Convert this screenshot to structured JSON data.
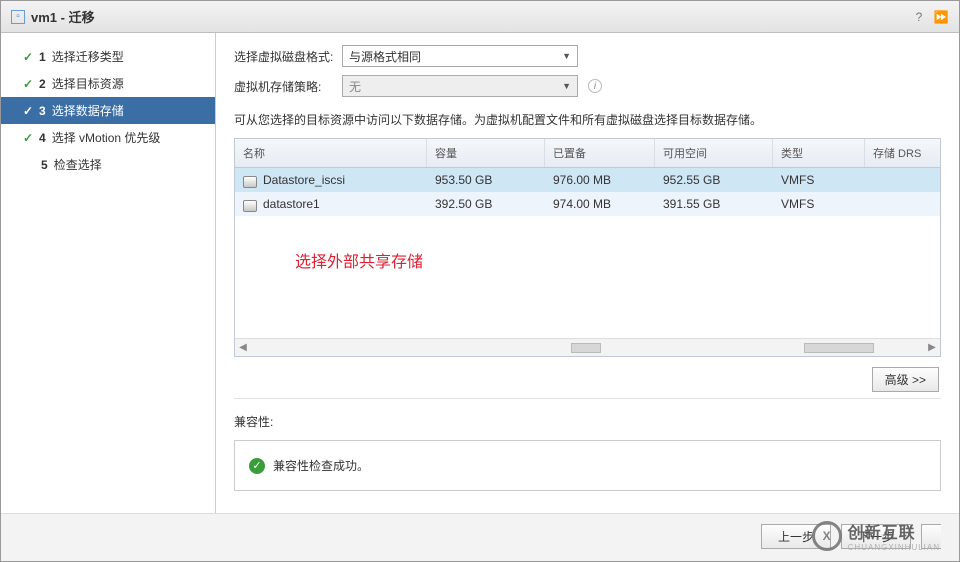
{
  "title": "vm1 - 迁移",
  "steps": [
    {
      "num": "1",
      "label": "选择迁移类型",
      "done": true
    },
    {
      "num": "2",
      "label": "选择目标资源",
      "done": true
    },
    {
      "num": "3",
      "label": "选择数据存储",
      "done": true,
      "active": true
    },
    {
      "num": "4",
      "label": "选择 vMotion 优先级",
      "done": true
    },
    {
      "num": "5",
      "label": "检查选择",
      "done": false
    }
  ],
  "form": {
    "diskFormatLabel": "选择虚拟磁盘格式:",
    "diskFormatValue": "与源格式相同",
    "policyLabel": "虚拟机存储策略:",
    "policyValue": "无"
  },
  "desc": "可从您选择的目标资源中访问以下数据存储。为虚拟机配置文件和所有虚拟磁盘选择目标数据存储。",
  "table": {
    "headers": {
      "name": "名称",
      "cap": "容量",
      "prov": "已置备",
      "free": "可用空间",
      "type": "类型",
      "drs": "存储 DRS"
    },
    "rows": [
      {
        "name": "Datastore_iscsi",
        "cap": "953.50 GB",
        "prov": "976.00 MB",
        "free": "952.55 GB",
        "type": "VMFS"
      },
      {
        "name": "datastore1",
        "cap": "392.50 GB",
        "prov": "974.00 MB",
        "free": "391.55 GB",
        "type": "VMFS"
      }
    ]
  },
  "annotation": "选择外部共享存储",
  "advancedBtn": "高级 >>",
  "compatLabel": "兼容性:",
  "compatMsg": "兼容性检查成功。",
  "footer": {
    "back": "上一步",
    "next": "下一步"
  },
  "brand": {
    "name": "创新互联",
    "sub": "CHUANGXINHULIAN"
  }
}
